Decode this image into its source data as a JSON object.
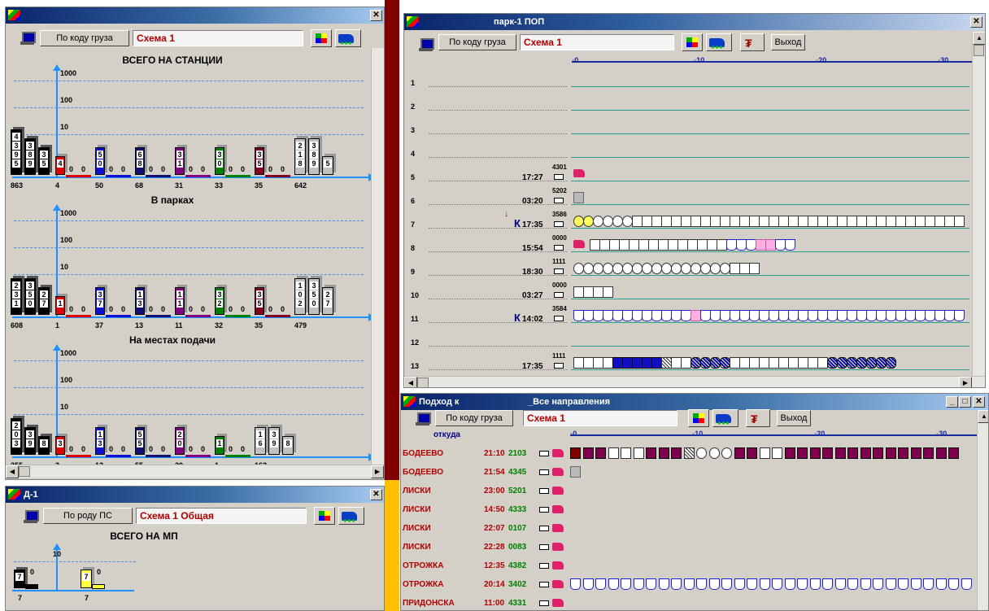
{
  "colors": {
    "title_bar": "#0a246a",
    "scheme_text": "#b00000",
    "axis": "#1e90ff",
    "divider_red": "#800000",
    "divider_yellow": "#ffc000"
  },
  "win1": {
    "btn_cargo": "По коду груза",
    "scheme": "Схема 1",
    "charts": [
      {
        "title": "ВСЕГО НА СТАНЦИИ",
        "axis_ticks": [
          "1000",
          "100",
          "10",
          "1"
        ],
        "bars": [
          {
            "color": "black",
            "digits": [
              "4",
              "3",
              "9",
              "5"
            ],
            "total": "863"
          },
          {
            "color": "black",
            "digits": [
              "3",
              "8",
              "9"
            ]
          },
          {
            "color": "black",
            "digits": [
              "3",
              "5"
            ]
          },
          {
            "color": "red",
            "digits": [
              "4"
            ],
            "total": "4"
          },
          {
            "color": "red",
            "digits": [
              "0"
            ]
          },
          {
            "color": "red",
            "digits": [
              "0"
            ]
          },
          {
            "color": "blue",
            "digits": [
              "5",
              "0"
            ],
            "total": "50"
          },
          {
            "color": "blue",
            "digits": [
              "0"
            ]
          },
          {
            "color": "blue",
            "digits": [
              "0"
            ]
          },
          {
            "color": "navy",
            "digits": [
              "6",
              "8"
            ],
            "total": "68"
          },
          {
            "color": "navy",
            "digits": [
              "0"
            ]
          },
          {
            "color": "navy",
            "digits": [
              "0"
            ]
          },
          {
            "color": "purple",
            "digits": [
              "3",
              "1"
            ],
            "total": "31"
          },
          {
            "color": "purple",
            "digits": [
              "0"
            ]
          },
          {
            "color": "purple",
            "digits": [
              "0"
            ]
          },
          {
            "color": "green",
            "digits": [
              "3",
              "0"
            ],
            "total": "33"
          },
          {
            "color": "green",
            "digits": [
              "0"
            ]
          },
          {
            "color": "green",
            "digits": [
              "0"
            ]
          },
          {
            "color": "maroon",
            "digits": [
              "3",
              "5"
            ],
            "total": "35"
          },
          {
            "color": "maroon",
            "digits": [
              "0"
            ]
          },
          {
            "color": "maroon",
            "digits": [
              "0"
            ]
          },
          {
            "color": "gray",
            "digits": [
              "2",
              "1",
              "8"
            ],
            "total": "642"
          },
          {
            "color": "gray",
            "digits": [
              "3",
              "8",
              "9"
            ]
          },
          {
            "color": "gray",
            "digits": [
              "5"
            ]
          }
        ]
      },
      {
        "title": "В парках",
        "axis_ticks": [
          "1000",
          "100",
          "10",
          "1"
        ],
        "bars": [
          {
            "color": "black",
            "digits": [
              "2",
              "3",
              "1"
            ],
            "total": "608"
          },
          {
            "color": "black",
            "digits": [
              "3",
              "5",
              "0"
            ]
          },
          {
            "color": "black",
            "digits": [
              "2",
              "7"
            ]
          },
          {
            "color": "red",
            "digits": [
              "1"
            ],
            "total": "1"
          },
          {
            "color": "red",
            "digits": [
              "0"
            ]
          },
          {
            "color": "red",
            "digits": [
              "0"
            ]
          },
          {
            "color": "blue",
            "digits": [
              "3",
              "7"
            ],
            "total": "37"
          },
          {
            "color": "blue",
            "digits": [
              "0"
            ]
          },
          {
            "color": "blue",
            "digits": [
              "0"
            ]
          },
          {
            "color": "navy",
            "digits": [
              "1",
              "3"
            ],
            "total": "13"
          },
          {
            "color": "navy",
            "digits": [
              "0"
            ]
          },
          {
            "color": "navy",
            "digits": [
              "0"
            ]
          },
          {
            "color": "purple",
            "digits": [
              "1",
              "1"
            ],
            "total": "11"
          },
          {
            "color": "purple",
            "digits": [
              "0"
            ]
          },
          {
            "color": "purple",
            "digits": [
              "0"
            ]
          },
          {
            "color": "green",
            "digits": [
              "3",
              "2"
            ],
            "total": "32"
          },
          {
            "color": "green",
            "digits": [
              "0"
            ]
          },
          {
            "color": "green",
            "digits": [
              "0"
            ]
          },
          {
            "color": "maroon",
            "digits": [
              "3",
              "5"
            ],
            "total": "35"
          },
          {
            "color": "maroon",
            "digits": [
              "0"
            ]
          },
          {
            "color": "maroon",
            "digits": [
              "0"
            ]
          },
          {
            "color": "gray",
            "digits": [
              "1",
              "0",
              "2"
            ],
            "total": "479"
          },
          {
            "color": "gray",
            "digits": [
              "3",
              "5",
              "0"
            ]
          },
          {
            "color": "gray",
            "digits": [
              "2",
              "7"
            ]
          }
        ]
      },
      {
        "title": "На местах подачи",
        "axis_ticks": [
          "1000",
          "100",
          "10",
          "1"
        ],
        "bars": [
          {
            "color": "black",
            "digits": [
              "2",
              "0",
              "3"
            ],
            "total": "255"
          },
          {
            "color": "black",
            "digits": [
              "3",
              "9"
            ]
          },
          {
            "color": "black",
            "digits": [
              "8"
            ]
          },
          {
            "color": "red",
            "digits": [
              "3"
            ],
            "total": "3"
          },
          {
            "color": "red",
            "digits": [
              "0"
            ]
          },
          {
            "color": "red",
            "digits": [
              "0"
            ]
          },
          {
            "color": "blue",
            "digits": [
              "1",
              "3"
            ],
            "total": "13"
          },
          {
            "color": "blue",
            "digits": [
              "0"
            ]
          },
          {
            "color": "blue",
            "digits": [
              "0"
            ]
          },
          {
            "color": "navy",
            "digits": [
              "5",
              "5"
            ],
            "total": "55"
          },
          {
            "color": "navy",
            "digits": [
              "0"
            ]
          },
          {
            "color": "navy",
            "digits": [
              "0"
            ]
          },
          {
            "color": "purple",
            "digits": [
              "2",
              "0"
            ],
            "total": "20"
          },
          {
            "color": "purple",
            "digits": [
              "0"
            ]
          },
          {
            "color": "purple",
            "digits": [
              "0"
            ]
          },
          {
            "color": "green",
            "digits": [
              "1"
            ],
            "total": "1"
          },
          {
            "color": "green",
            "digits": [
              "0"
            ]
          },
          {
            "color": "green",
            "digits": [
              "0"
            ]
          },
          {
            "color": "gray",
            "digits": [
              "1",
              "6"
            ],
            "total": "163"
          },
          {
            "color": "gray",
            "digits": [
              "3",
              "9"
            ]
          },
          {
            "color": "gray",
            "digits": [
              "8"
            ]
          }
        ]
      }
    ]
  },
  "win2": {
    "title": "Д-1",
    "btn_type": "По роду ПС",
    "scheme": "Схема 1 Общая",
    "chart_title": "ВСЕГО НА МП",
    "axis_tick": "10",
    "bars": [
      {
        "color": "black",
        "digits": [
          "7"
        ],
        "zero": "0",
        "total": "7"
      },
      {
        "color": "yellow",
        "digits": [
          "7"
        ],
        "zero": "0",
        "total": "7"
      }
    ]
  },
  "win3": {
    "title": "парк-1 ПОП",
    "btn_cargo": "По коду груза",
    "scheme": "Схема 1",
    "btn_exit": "Выход",
    "ruler": [
      "0",
      "10",
      "20",
      "30"
    ],
    "rows": [
      {
        "n": "1"
      },
      {
        "n": "2"
      },
      {
        "n": "3"
      },
      {
        "n": "4"
      },
      {
        "n": "5",
        "time": "17:27",
        "num": "4301",
        "loco": true,
        "cars": ""
      },
      {
        "n": "6",
        "time": "03:20",
        "num": "5202",
        "cars": "g"
      },
      {
        "n": "7",
        "time": "17:35",
        "num": "3586",
        "k": "К",
        "down": "↓",
        "cars": "yyoooowwwwwwwwwwwwwwwwwwwwwwwwwwwwwwwwww"
      },
      {
        "n": "8",
        "time": "15:54",
        "num": "0000",
        "loco": true,
        "cars": "wwwwwwwwwwwwwwbbbppbb"
      },
      {
        "n": "9",
        "time": "18:30",
        "num": "1111",
        "cars": "oooooooooooooooowww"
      },
      {
        "n": "10",
        "time": "03:27",
        "num": "0000",
        "cars": "wwww"
      },
      {
        "n": "11",
        "time": "14:02",
        "num": "3584",
        "k": "К",
        "cars": "bbbbbbbbbbbbpbbbbbbbbbbbbbbbbbbbbbbbbbbb"
      },
      {
        "n": "12"
      },
      {
        "n": "13",
        "time": "17:35",
        "num": "1111",
        "cars": "wwwwBBBBBhwwnnnnwwwwwwwwwwnnnnnnn"
      }
    ]
  },
  "win4": {
    "title": "Подход к",
    "title2": "_Все направления",
    "btn_cargo": "По коду груза",
    "scheme": "Схема 1",
    "btn_exit": "Выход",
    "col_from": "откуда",
    "ruler": [
      "0",
      "10",
      "20",
      "30"
    ],
    "rows": [
      {
        "from": "БОДЕЕВО",
        "time": "21:10",
        "num": "2103",
        "loco": true,
        "cars": "kmmwwwmmmhooommwwmmmmmmmmmmmmmm"
      },
      {
        "from": "БОДЕЕВО",
        "time": "21:54",
        "num": "4345",
        "loco": true,
        "cars": "g"
      },
      {
        "from": "ЛИСКИ",
        "time": "23:00",
        "num": "5201",
        "loco": true,
        "cars": ""
      },
      {
        "from": "ЛИСКИ",
        "time": "14:50",
        "num": "4333",
        "loco": true,
        "cars": ""
      },
      {
        "from": "ЛИСКИ",
        "time": "22:07",
        "num": "0107",
        "loco": true,
        "cars": ""
      },
      {
        "from": "ЛИСКИ",
        "time": "22:28",
        "num": "0083",
        "loco": true,
        "cars": ""
      },
      {
        "from": "ОТРОЖКА",
        "time": "12:35",
        "num": "4382",
        "loco": true,
        "cars": ""
      },
      {
        "from": "ОТРОЖКА",
        "time": "20:14",
        "num": "3402",
        "loco": true,
        "cars": "bbbbbbbbbbbbbbbbbbbbbbbbbbbbbbbbbbbbbbbb"
      },
      {
        "from": "ПРИДОНСКА",
        "time": "11:00",
        "num": "4331",
        "loco": true,
        "cars": ""
      }
    ]
  }
}
